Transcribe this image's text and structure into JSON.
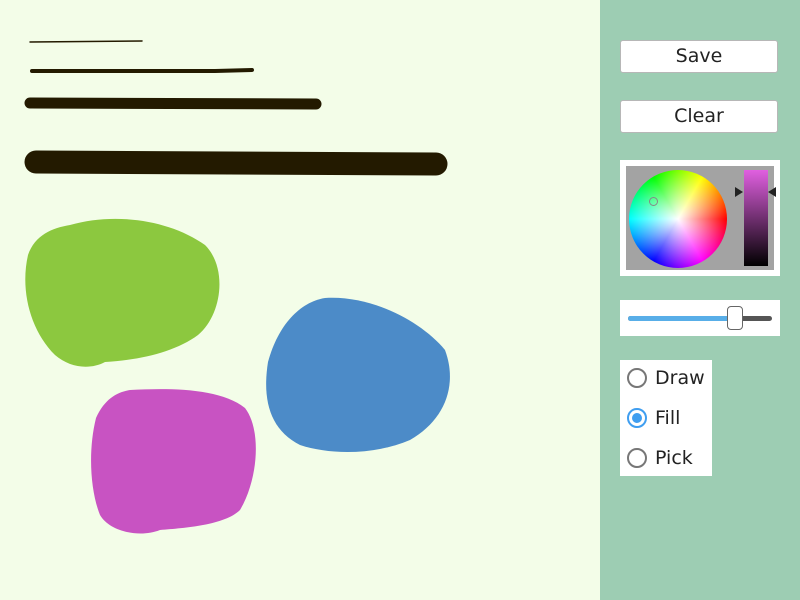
{
  "toolbar": {
    "save_label": "Save",
    "clear_label": "Clear"
  },
  "color_picker": {
    "selected_color": "#e060e0",
    "wheel": "hue-saturation-wheel",
    "lightness_bar": "lightness-slider"
  },
  "brush_size": {
    "value_fraction": 0.74,
    "track_color": "#555555",
    "fill_color": "#58aee8"
  },
  "tools": {
    "items": [
      {
        "label": "Draw",
        "selected": false
      },
      {
        "label": "Fill",
        "selected": true
      },
      {
        "label": "Pick",
        "selected": false
      }
    ]
  },
  "canvas": {
    "background": "#f3fde8",
    "stroke_color": "#231a00",
    "blob_colors": {
      "green": "#8cc83f",
      "blue": "#4c8bc8",
      "magenta": "#c853c2"
    }
  },
  "sidebar": {
    "background": "#9dcdb3"
  }
}
